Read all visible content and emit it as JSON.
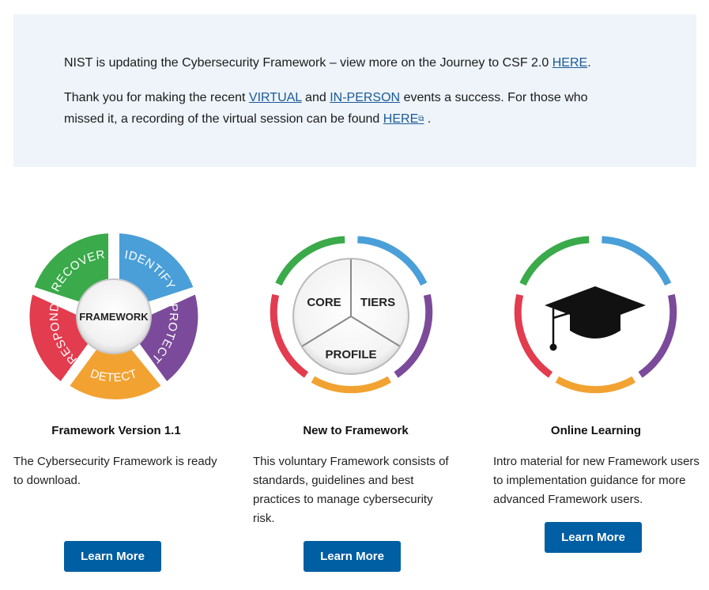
{
  "banner": {
    "line1_text": "NIST is updating the Cybersecurity Framework – view more on the Journey to CSF 2.0",
    "line1_link": "HERE",
    "line2_prefix": "Thank you for making the recent",
    "line2_link_virtual": "VIRTUAL",
    "line2_and": "and",
    "line2_link_inperson": "IN-PERSON",
    "line2_suffix": "events a success. For those who",
    "line3_prefix": "missed it, a recording of the virtual session can be found",
    "line3_link": "HERE",
    "line3_end": "."
  },
  "colors": {
    "banner_bg": "#eef4fa",
    "link": "#1a5a96",
    "button_bg": "#005ea2",
    "identify": "#4a9fd8",
    "protect": "#7b4a9a",
    "detect": "#f2a231",
    "respond": "#e23c4e",
    "recover": "#3aaa4a"
  },
  "cards": [
    {
      "title": "Framework Version 1.1",
      "description": "The Cybersecurity Framework is ready to download.",
      "button": "Learn More",
      "wheel": {
        "center": "FRAMEWORK",
        "segments": [
          "IDENTIFY",
          "PROTECT",
          "DETECT",
          "RESPOND",
          "RECOVER"
        ]
      }
    },
    {
      "title": "New to Framework",
      "description": "This voluntary Framework consists of standards, guidelines and best practices to manage cybersecurity risk.",
      "button": "Learn More",
      "wheel": {
        "labels": [
          "CORE",
          "TIERS",
          "PROFILE"
        ]
      }
    },
    {
      "title": "Online Learning",
      "description": "Intro material for new Framework users to implementation guidance for more advanced Framework users.",
      "button": "Learn More",
      "icon": "graduation-cap-icon"
    }
  ]
}
